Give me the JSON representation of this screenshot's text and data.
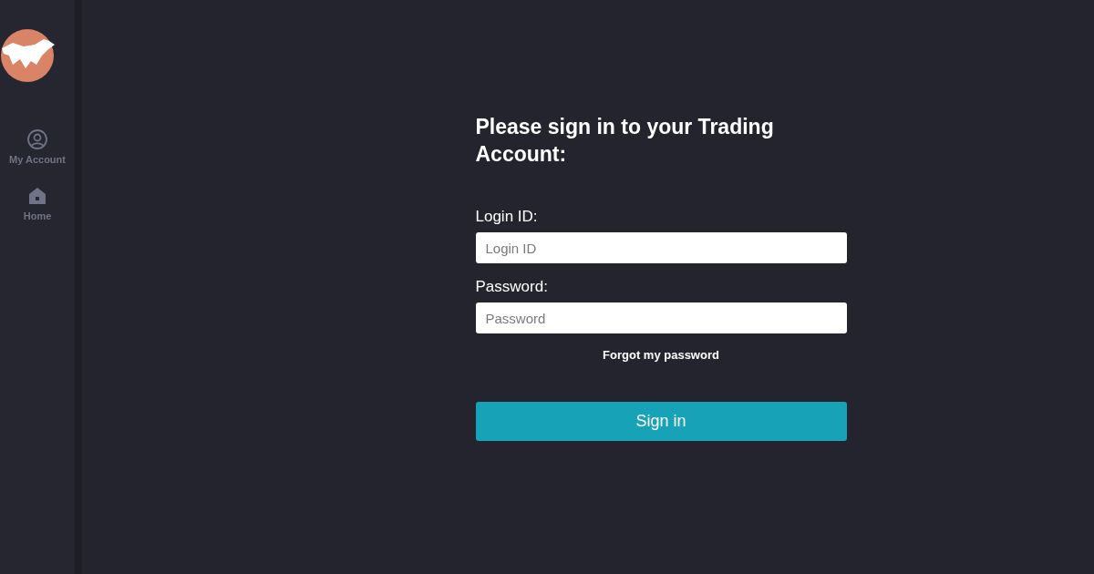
{
  "sidebar": {
    "items": [
      {
        "kind": "account",
        "label": "My Account",
        "selected": false
      },
      {
        "kind": "home",
        "label": "Home",
        "selected": false
      }
    ]
  },
  "form": {
    "title": "Please sign in to your Trading Account:",
    "fields": [
      {
        "label": "Login ID:",
        "placeholder": "Login ID"
      },
      {
        "label": "Password:",
        "placeholder": "Password"
      }
    ],
    "forgot_link": "Forgot my password",
    "submit": "Sign in"
  }
}
